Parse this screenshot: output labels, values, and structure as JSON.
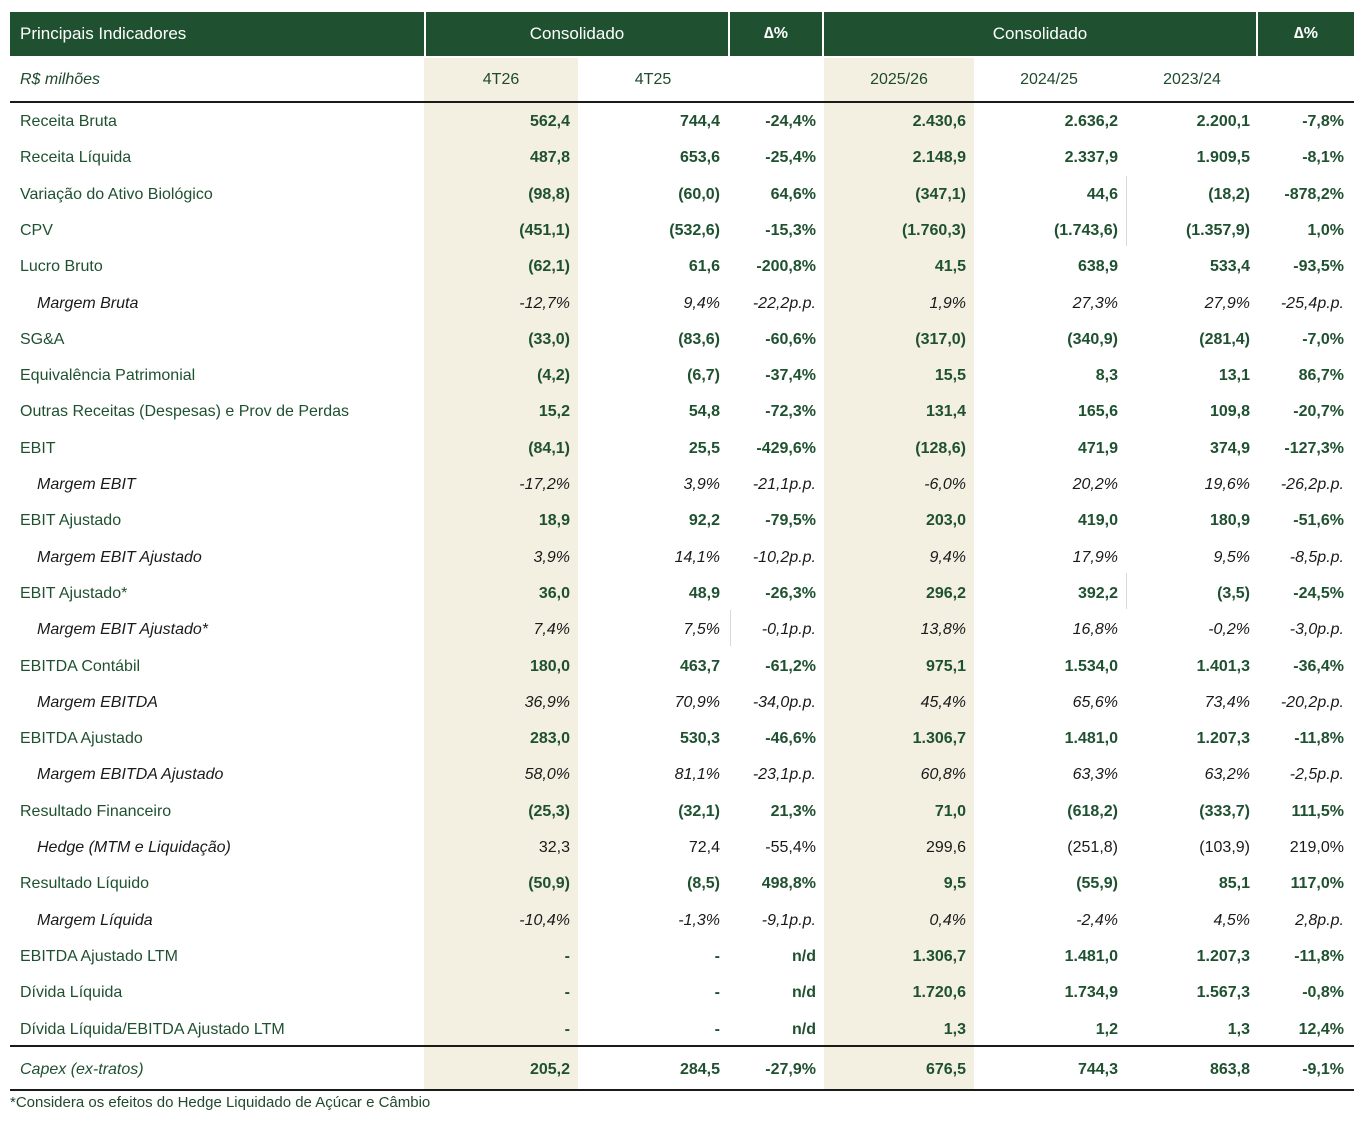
{
  "header": {
    "title": "Principais Indicadores",
    "group_quarter": "Consolidado",
    "delta1": "∆%",
    "group_year": "Consolidado",
    "delta2": "∆%"
  },
  "subheader": {
    "unit": "R$ milhões",
    "q_current": "4T26",
    "q_prior": "4T25",
    "y_current": "2025/26",
    "y_prior": "2024/25",
    "y_prior2": "2023/24"
  },
  "rows": [
    {
      "label": "Receita Bruta",
      "style": "bold",
      "v": [
        "562,4",
        "744,4",
        "-24,4%",
        "2.430,6",
        "2.636,2",
        "2.200,1",
        "-7,8%"
      ]
    },
    {
      "label": "Receita Líquida",
      "style": "bold",
      "v": [
        "487,8",
        "653,6",
        "-25,4%",
        "2.148,9",
        "2.337,9",
        "1.909,5",
        "-8,1%"
      ]
    },
    {
      "label": "Variação do Ativo Biológico",
      "style": "bold",
      "v": [
        "(98,8)",
        "(60,0)",
        "64,6%",
        "(347,1)",
        "44,6",
        "(18,2)",
        "-878,2%"
      ]
    },
    {
      "label": "CPV",
      "style": "bold",
      "v": [
        "(451,1)",
        "(532,6)",
        "-15,3%",
        "(1.760,3)",
        "(1.743,6)",
        "(1.357,9)",
        "1,0%"
      ]
    },
    {
      "label": "Lucro Bruto",
      "style": "bold",
      "v": [
        "(62,1)",
        "61,6",
        "-200,8%",
        "41,5",
        "638,9",
        "533,4",
        "-93,5%"
      ]
    },
    {
      "label": "Margem Bruta",
      "style": "ital",
      "v": [
        "-12,7%",
        "9,4%",
        "-22,2p.p.",
        "1,9%",
        "27,3%",
        "27,9%",
        "-25,4p.p."
      ]
    },
    {
      "label": "SG&A",
      "style": "bold",
      "v": [
        "(33,0)",
        "(83,6)",
        "-60,6%",
        "(317,0)",
        "(340,9)",
        "(281,4)",
        "-7,0%"
      ]
    },
    {
      "label": "Equivalência Patrimonial",
      "style": "bold",
      "v": [
        "(4,2)",
        "(6,7)",
        "-37,4%",
        "15,5",
        "8,3",
        "13,1",
        "86,7%"
      ]
    },
    {
      "label": "Outras Receitas (Despesas) e Prov de Perdas",
      "style": "bold",
      "v": [
        "15,2",
        "54,8",
        "-72,3%",
        "131,4",
        "165,6",
        "109,8",
        "-20,7%"
      ]
    },
    {
      "label": "EBIT",
      "style": "bold",
      "v": [
        "(84,1)",
        "25,5",
        "-429,6%",
        "(128,6)",
        "471,9",
        "374,9",
        "-127,3%"
      ]
    },
    {
      "label": "Margem EBIT",
      "style": "ital",
      "v": [
        "-17,2%",
        "3,9%",
        "-21,1p.p.",
        "-6,0%",
        "20,2%",
        "19,6%",
        "-26,2p.p."
      ]
    },
    {
      "label": "EBIT Ajustado",
      "style": "bold",
      "v": [
        "18,9",
        "92,2",
        "-79,5%",
        "203,0",
        "419,0",
        "180,9",
        "-51,6%"
      ]
    },
    {
      "label": "Margem EBIT Ajustado",
      "style": "ital",
      "v": [
        "3,9%",
        "14,1%",
        "-10,2p.p.",
        "9,4%",
        "17,9%",
        "9,5%",
        "-8,5p.p."
      ]
    },
    {
      "label": "EBIT Ajustado*",
      "style": "bold",
      "v": [
        "36,0",
        "48,9",
        "-26,3%",
        "296,2",
        "392,2",
        "(3,5)",
        "-24,5%"
      ]
    },
    {
      "label": "Margem EBIT Ajustado*",
      "style": "ital",
      "v": [
        "7,4%",
        "7,5%",
        "-0,1p.p.",
        "13,8%",
        "16,8%",
        "-0,2%",
        "-3,0p.p."
      ]
    },
    {
      "label": "EBITDA Contábil",
      "style": "bold",
      "v": [
        "180,0",
        "463,7",
        "-61,2%",
        "975,1",
        "1.534,0",
        "1.401,3",
        "-36,4%"
      ]
    },
    {
      "label": "Margem EBITDA",
      "style": "ital",
      "v": [
        "36,9%",
        "70,9%",
        "-34,0p.p.",
        "45,4%",
        "65,6%",
        "73,4%",
        "-20,2p.p."
      ]
    },
    {
      "label": "EBITDA Ajustado",
      "style": "bold",
      "v": [
        "283,0",
        "530,3",
        "-46,6%",
        "1.306,7",
        "1.481,0",
        "1.207,3",
        "-11,8%"
      ]
    },
    {
      "label": "Margem EBITDA Ajustado",
      "style": "ital",
      "v": [
        "58,0%",
        "81,1%",
        "-23,1p.p.",
        "60,8%",
        "63,3%",
        "63,2%",
        "-2,5p.p."
      ]
    },
    {
      "label": "Resultado Financeiro",
      "style": "bold",
      "v": [
        "(25,3)",
        "(32,1)",
        "21,3%",
        "71,0",
        "(618,2)",
        "(333,7)",
        "111,5%"
      ]
    },
    {
      "label": "Hedge (MTM e Liquidação)",
      "style": "ital-plain",
      "v": [
        "32,3",
        "72,4",
        "-55,4%",
        "299,6",
        "(251,8)",
        "(103,9)",
        "219,0%"
      ]
    },
    {
      "label": "Resultado Líquido",
      "style": "bold",
      "v": [
        "(50,9)",
        "(8,5)",
        "498,8%",
        "9,5",
        "(55,9)",
        "85,1",
        "117,0%"
      ]
    },
    {
      "label": "Margem Líquida",
      "style": "ital",
      "v": [
        "-10,4%",
        "-1,3%",
        "-9,1p.p.",
        "0,4%",
        "-2,4%",
        "4,5%",
        "2,8p.p."
      ]
    },
    {
      "label": "EBITDA Ajustado LTM",
      "style": "bold",
      "v": [
        "-",
        "-",
        "n/d",
        "1.306,7",
        "1.481,0",
        "1.207,3",
        "-11,8%"
      ]
    },
    {
      "label": "Dívida Líquida",
      "style": "bold",
      "v": [
        "-",
        "-",
        "n/d",
        "1.720,6",
        "1.734,9",
        "1.567,3",
        "-0,8%"
      ]
    },
    {
      "label": "Dívida Líquida/EBITDA Ajustado LTM",
      "style": "bold",
      "v": [
        "-",
        "-",
        "n/d",
        "1,3",
        "1,2",
        "1,3",
        "12,4%"
      ]
    }
  ],
  "capex": {
    "label": "Capex (ex-tratos)",
    "v": [
      "205,2",
      "284,5",
      "-27,9%",
      "676,5",
      "744,3",
      "863,8",
      "-9,1%"
    ]
  },
  "footnote": "*Considera os efeitos do Hedge Liquidado de Açúcar e Câmbio"
}
